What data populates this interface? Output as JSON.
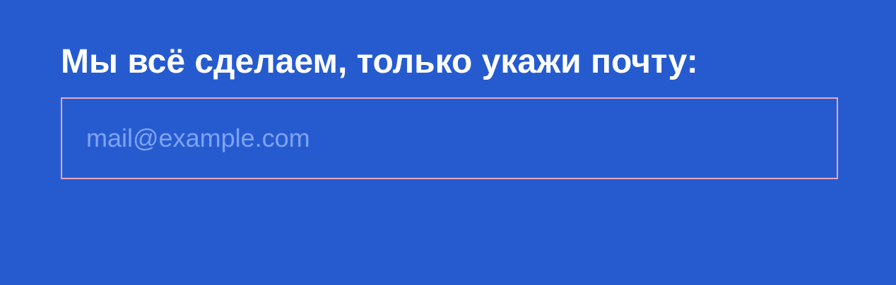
{
  "form": {
    "heading": "Мы всё сделаем, только укажи почту:",
    "email": {
      "value": "",
      "placeholder": "mail@example.com"
    }
  },
  "colors": {
    "background": "#265bd0",
    "heading_text": "#ffffff",
    "input_border": "#e8a8bd",
    "placeholder_text": "#7fa3f2"
  }
}
